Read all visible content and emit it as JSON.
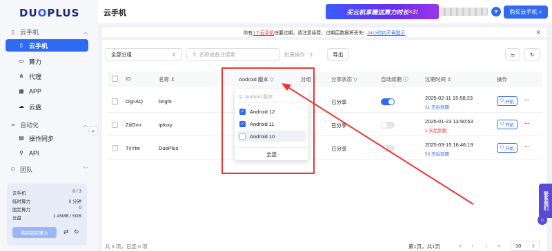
{
  "brand": {
    "logo": "DUOPLUS"
  },
  "sidebar": {
    "group_cloud": "云手机",
    "items": [
      {
        "label": "云手机",
        "icon": "phone-icon"
      },
      {
        "label": "算力",
        "icon": "monitor-icon"
      },
      {
        "label": "代理",
        "icon": "proxy-icon"
      },
      {
        "label": "APP",
        "icon": "grid-icon"
      },
      {
        "label": "云盘",
        "icon": "cloud-icon"
      }
    ],
    "group_auto": "自动化",
    "auto_items": [
      {
        "label": "操作同步",
        "icon": "sync-icon"
      },
      {
        "label": "API",
        "icon": "api-icon"
      }
    ],
    "group_team": "团队",
    "stats": [
      {
        "label": "云手机",
        "value": "0 / 3"
      },
      {
        "label": "临时算力",
        "value": "0 分钟"
      },
      {
        "label": "固定算力",
        "value": "0"
      },
      {
        "label": "云盘",
        "value": "1.45MB / 5GB"
      }
    ],
    "buy_fixed": "购买固定算力"
  },
  "header": {
    "title": "云手机",
    "promo_a": "买云机",
    "promo_b": " 享赠送算力时长",
    "promo_c": "×3!",
    "buy_button": "购买云手机 +"
  },
  "notice": {
    "pre": "你有",
    "count": "1个云手机",
    "post": "快要过期，请注意续费，过期后数据将丢失!",
    "link": "24小时内不再提示"
  },
  "toolbar": {
    "group_select": "全部分组",
    "search_placeholder": "名称或备注搜索",
    "batch": "批量操作",
    "export": "导出"
  },
  "table": {
    "headers": {
      "id": "ID",
      "name": "名称",
      "android": "Android 版本",
      "group": "分组",
      "share": "分享状态",
      "renew": "自动续期",
      "expire": "过期时间",
      "op": "操作"
    },
    "rows": [
      {
        "id": "OgnAQ",
        "name": "bright",
        "share": "已分享",
        "renew": true,
        "expire": "2025-02-11 15:58:23",
        "remain": "21 天后到期",
        "remain_color": "#2f6bf0",
        "power": "开机"
      },
      {
        "id": "ZdOvn",
        "name": "ipfoxy",
        "share": "已分享",
        "renew": false,
        "expire": "2025-01-23 13:50:53",
        "remain": "1 天后到期",
        "remain_color": "#e23030",
        "power": "开机"
      },
      {
        "id": "TvYtw",
        "name": "DuoPlus",
        "share": "已分享",
        "renew": false,
        "expire": "2025-03-15 16:46:19",
        "remain": "53 天后到期",
        "remain_color": "#2f6bf0",
        "power": "开机"
      }
    ]
  },
  "dropdown": {
    "search_placeholder": "Android 版本",
    "options": [
      {
        "label": "Android 12",
        "checked": true
      },
      {
        "label": "Android 11",
        "checked": true
      },
      {
        "label": "Android 10",
        "checked": false
      }
    ],
    "select_all": "全选"
  },
  "footer": {
    "summary": "共 3 项，已选 0 项",
    "page_info": "第1页，共1页",
    "page_size": "10"
  },
  "float": {
    "contact": "联系我们"
  },
  "colors": {
    "accent": "#2f6bf0",
    "highlight": "#e33333"
  }
}
